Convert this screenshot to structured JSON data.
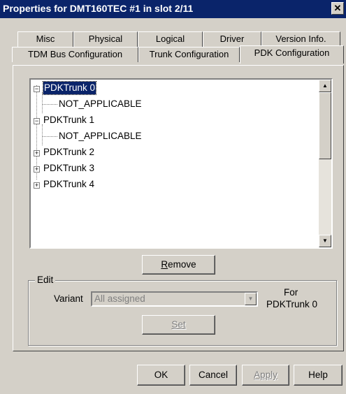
{
  "window": {
    "title": "Properties for DMT160TEC #1 in slot 2/11",
    "close_glyph": "✕"
  },
  "tabs_row1": [
    "Misc",
    "Physical",
    "Logical",
    "Driver",
    "Version Info."
  ],
  "tabs_row2": [
    "TDM Bus Configuration",
    "Trunk Configuration",
    "PDK Configuration"
  ],
  "active_tab": "PDK Configuration",
  "tree": {
    "nodes": [
      {
        "label": "PDKTrunk 0",
        "expanded": true,
        "selected": true
      },
      {
        "label": "NOT_APPLICABLE",
        "child": true
      },
      {
        "label": "PDKTrunk 1",
        "expanded": true
      },
      {
        "label": "NOT_APPLICABLE",
        "child": true
      },
      {
        "label": "PDKTrunk 2",
        "expanded": false
      },
      {
        "label": "PDKTrunk 3",
        "expanded": false
      },
      {
        "label": "PDKTrunk 4",
        "expanded": false
      }
    ],
    "scroll_up_icon": "▲",
    "scroll_down_icon": "▼"
  },
  "remove_button": {
    "accel": "R",
    "rest": "emove"
  },
  "edit_group": {
    "label": "Edit",
    "variant_label": "Variant",
    "variant_value": "All assigned",
    "combo_icon": "▼",
    "for_line1": "For",
    "for_line2": "PDKTrunk 0",
    "set_button": "Set"
  },
  "footer": {
    "ok": "OK",
    "cancel": "Cancel",
    "apply": "Apply",
    "help": "Help"
  }
}
